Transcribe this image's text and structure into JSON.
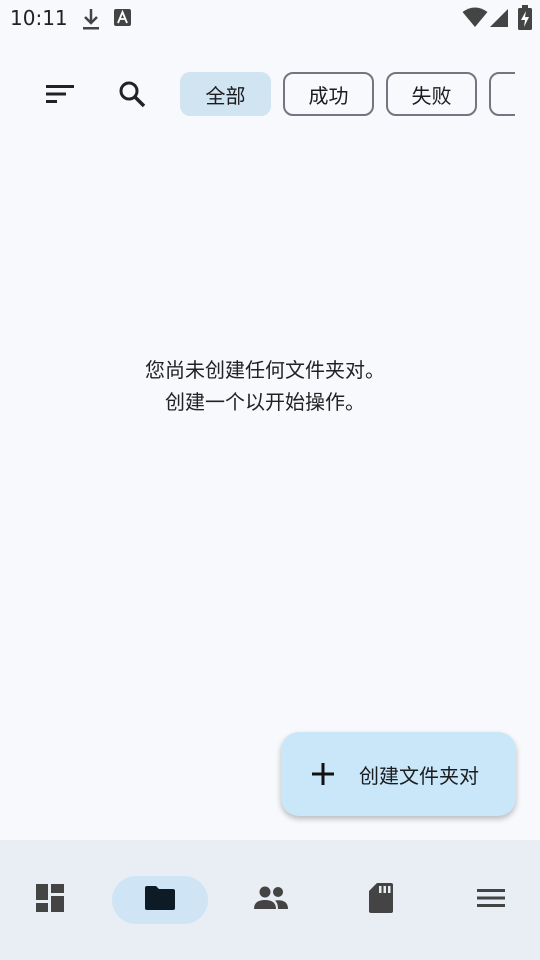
{
  "status_bar": {
    "time": "10:11",
    "icons": [
      "download-icon",
      "font-a-icon",
      "wifi-icon",
      "cell-signal-icon",
      "battery-charging-icon"
    ]
  },
  "toolbar": {
    "sort_icon": "sort-icon",
    "search_icon": "search-icon",
    "filters": [
      {
        "label": "全部",
        "selected": true
      },
      {
        "label": "成功",
        "selected": false
      },
      {
        "label": "失败",
        "selected": false
      },
      {
        "label": "",
        "selected": false
      }
    ]
  },
  "empty_state": {
    "line1": "您尚未创建任何文件夹对。",
    "line2": "创建一个以开始操作。"
  },
  "fab": {
    "icon": "plus-icon",
    "label": "创建文件夹对"
  },
  "bottom_nav": {
    "items": [
      {
        "icon": "dashboard-icon",
        "selected": false
      },
      {
        "icon": "folder-icon",
        "selected": true
      },
      {
        "icon": "people-icon",
        "selected": false
      },
      {
        "icon": "sd-card-icon",
        "selected": false
      },
      {
        "icon": "menu-icon",
        "selected": false
      }
    ]
  },
  "colors": {
    "background": "#f8f9fd",
    "selected_chip": "#d1e4f2",
    "fab": "#c9e7f9",
    "bottom_nav": "#e8eef4"
  }
}
